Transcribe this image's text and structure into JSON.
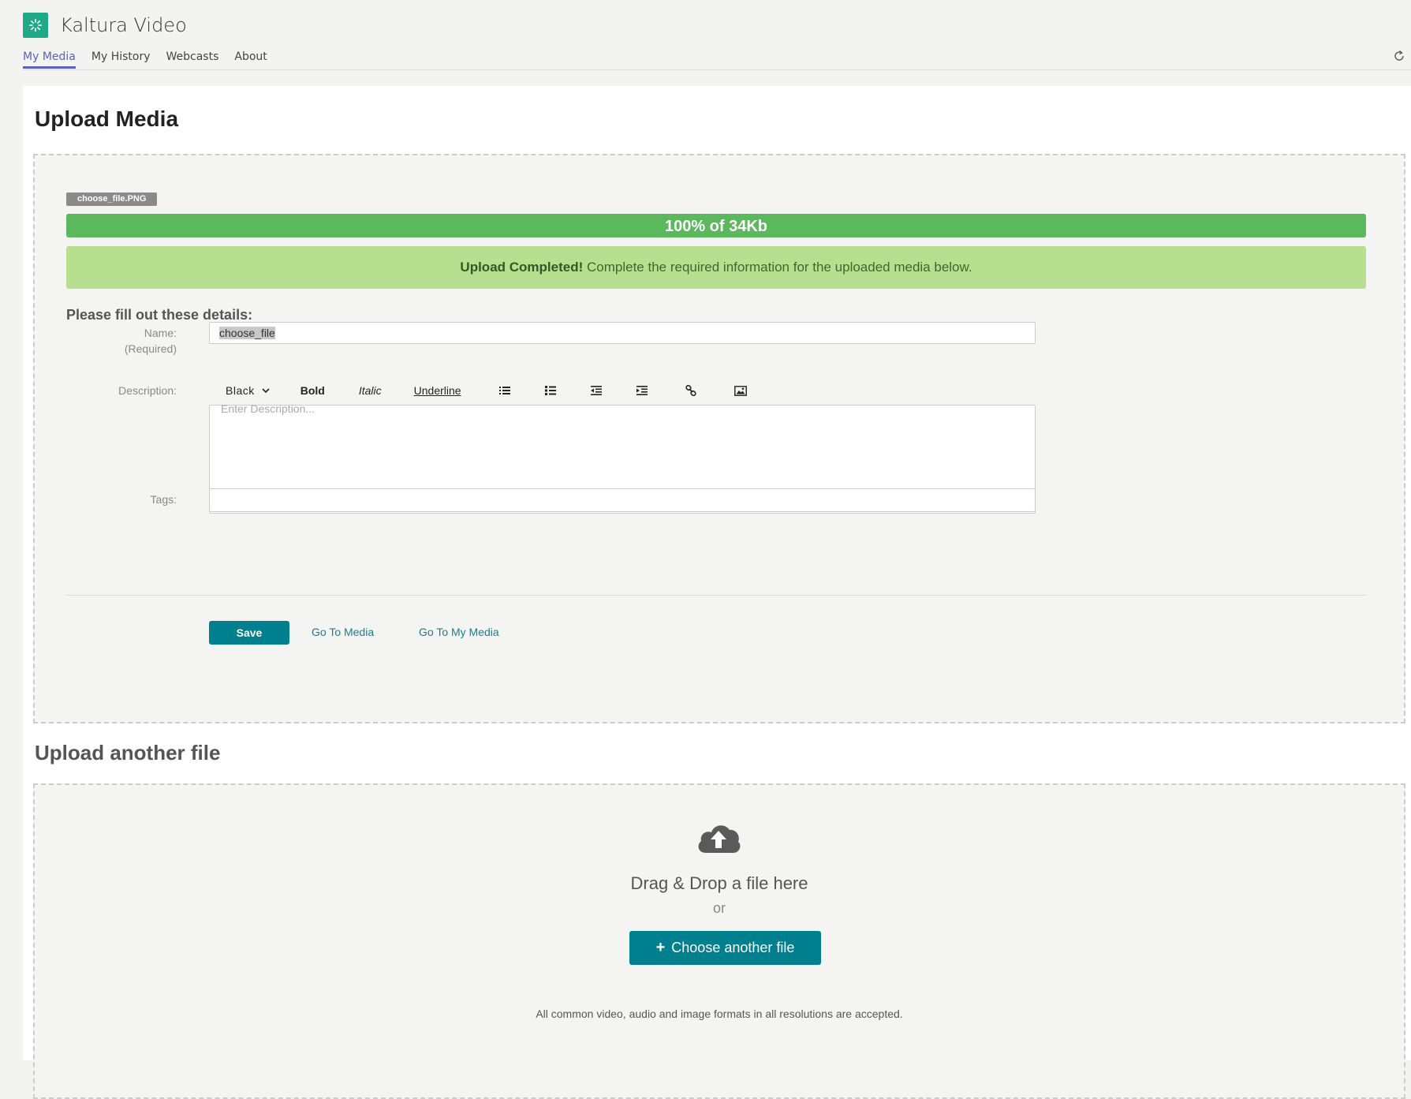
{
  "app": {
    "title": "Kaltura Video"
  },
  "tabs": [
    {
      "label": "My Media",
      "active": true
    },
    {
      "label": "My History"
    },
    {
      "label": "Webcasts"
    },
    {
      "label": "About"
    }
  ],
  "page": {
    "title": "Upload Media"
  },
  "upload": {
    "file_name": "choose_file.PNG",
    "progress_label": "100% of 34Kb",
    "progress_fraction": 1.0,
    "alert_bold": "Upload Completed!",
    "alert_text": " Complete the required information for the uploaded media below."
  },
  "form": {
    "title": "Please fill out these details:",
    "name_label": "Name:",
    "name_required": "(Required)",
    "name_value": "choose_file",
    "description_label": "Description:",
    "description_placeholder": "Enter Description...",
    "tags_label": "Tags:",
    "toolbar": {
      "color": "Black",
      "bold": "Bold",
      "italic": "Italic",
      "underline": "Underline"
    },
    "save_label": "Save",
    "go_to_media": "Go To Media",
    "go_to_my_media": "Go To My Media"
  },
  "another": {
    "title": "Upload another file",
    "drop_text": "Drag & Drop a file here",
    "or_text": "or",
    "choose_label": "Choose another file",
    "accept_text": "All common video, audio and image formats in all resolutions are accepted."
  },
  "colors": {
    "accent": "#00808f",
    "progress": "#5cb85c",
    "alert_bg": "#b8df90",
    "tab_active": "#5b5fc7",
    "logo": "#1fa986"
  }
}
